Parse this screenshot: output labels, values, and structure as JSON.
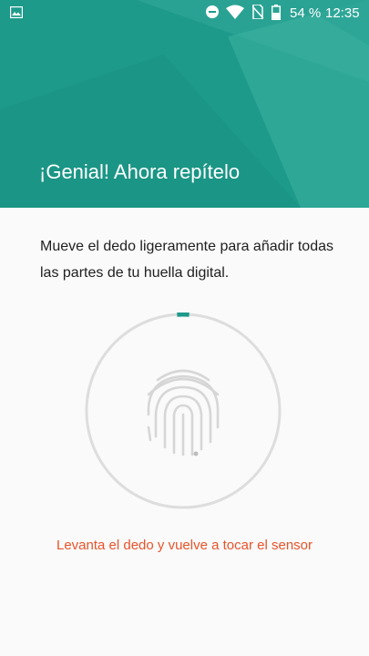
{
  "status_bar": {
    "battery_text": "54 %",
    "time": "12:35",
    "icons": [
      "image-notification-icon",
      "do-not-disturb-icon",
      "wifi-icon",
      "no-sim-icon",
      "battery-icon"
    ]
  },
  "header": {
    "title": "¡Genial! Ahora repítelo"
  },
  "main": {
    "description": "Mueve el dedo ligeramente para añadir todas las partes de tu huella digital.",
    "enrollment_progress": 0.02,
    "error_message": "Levanta el dedo y vuelve a tocar el sensor"
  },
  "colors": {
    "accent": "#1e9a8a",
    "error": "#e8542a",
    "ring_track": "#dddddd",
    "fingerprint": "#d6d6d6"
  }
}
